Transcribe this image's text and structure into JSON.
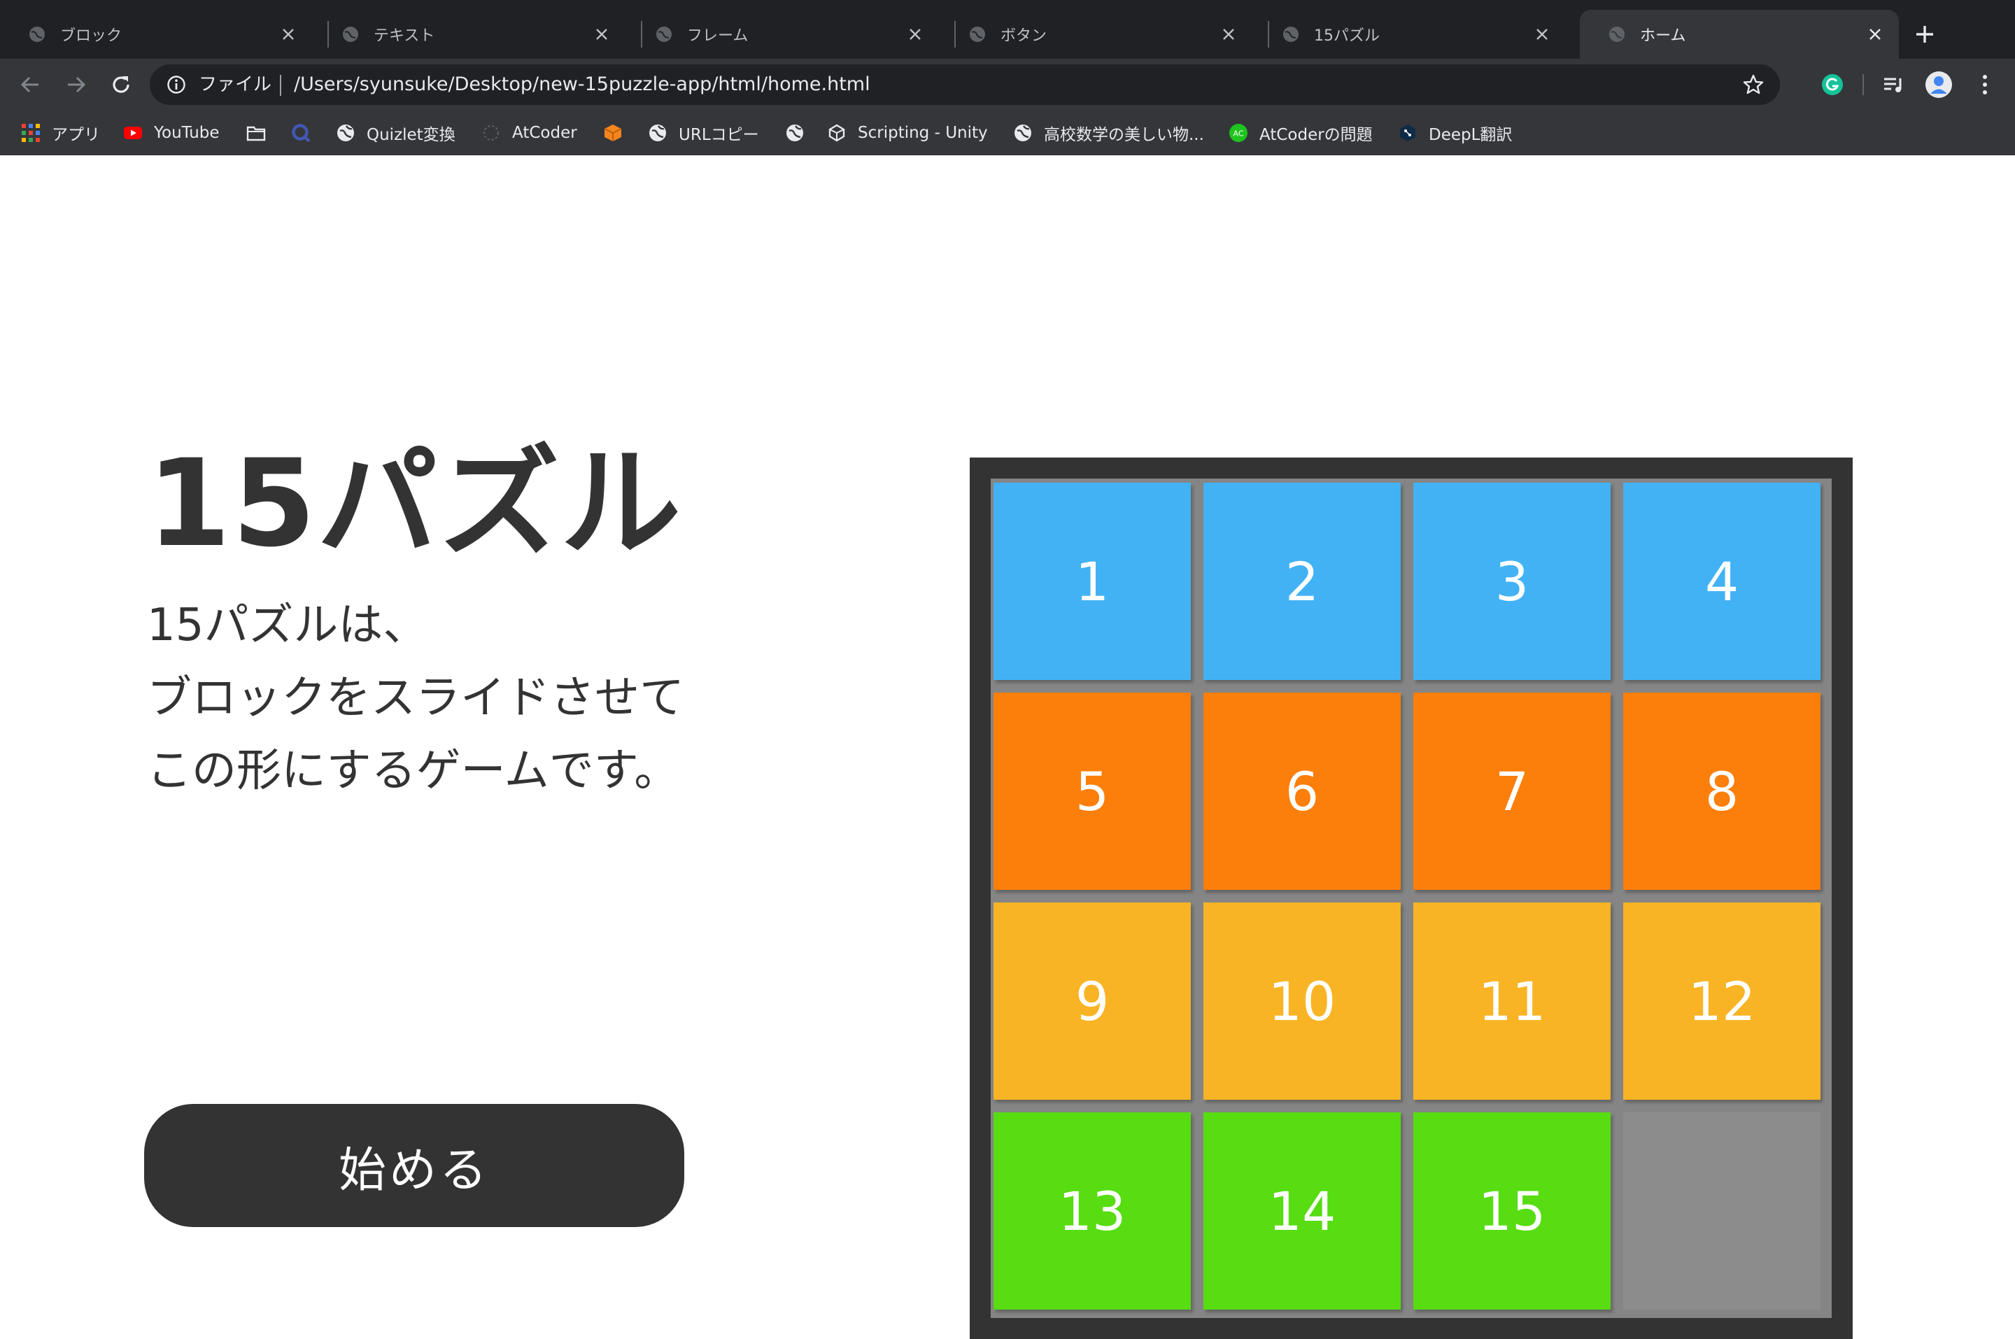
{
  "browser": {
    "tabs": [
      {
        "title": "ブロック",
        "active": false
      },
      {
        "title": "テキスト",
        "active": false
      },
      {
        "title": "フレーム",
        "active": false
      },
      {
        "title": "ボタン",
        "active": false
      },
      {
        "title": "15パズル",
        "active": false
      },
      {
        "title": "ホーム",
        "active": true
      }
    ],
    "address": {
      "scheme_label": "ファイル",
      "url": "/Users/syunsuke/Desktop/new-15puzzle-app/html/home.html"
    },
    "bookmarks": [
      {
        "label": "アプリ",
        "icon": "apps-grid-icon"
      },
      {
        "label": "YouTube",
        "icon": "youtube-icon"
      },
      {
        "label": "",
        "icon": "folder-icon"
      },
      {
        "label": "",
        "icon": "quizlet-icon"
      },
      {
        "label": "Quizlet変換",
        "icon": "globe-icon"
      },
      {
        "label": "AtCoder",
        "icon": "atcoder-icon"
      },
      {
        "label": "",
        "icon": "box-icon"
      },
      {
        "label": "URLコピー",
        "icon": "globe-icon"
      },
      {
        "label": "",
        "icon": "globe-icon"
      },
      {
        "label": "Scripting - Unity",
        "icon": "unity-icon"
      },
      {
        "label": "高校数学の美しい物...",
        "icon": "globe-icon"
      },
      {
        "label": "AtCoderの問題",
        "icon": "ac-icon"
      },
      {
        "label": "DeepL翻訳",
        "icon": "deepl-icon"
      }
    ]
  },
  "page": {
    "title": "15パズル",
    "description_lines": [
      "15パズルは、",
      "ブロックをスライドさせて",
      "この形にするゲームです。"
    ],
    "start_button_label": "始める"
  },
  "puzzle": {
    "tiles": [
      {
        "label": "1",
        "color": "#42b2f4"
      },
      {
        "label": "2",
        "color": "#42b2f4"
      },
      {
        "label": "3",
        "color": "#42b2f4"
      },
      {
        "label": "4",
        "color": "#42b2f4"
      },
      {
        "label": "5",
        "color": "#fc7e0b"
      },
      {
        "label": "6",
        "color": "#fc7e0b"
      },
      {
        "label": "7",
        "color": "#fc7e0b"
      },
      {
        "label": "8",
        "color": "#fc7e0b"
      },
      {
        "label": "9",
        "color": "#f8b424"
      },
      {
        "label": "10",
        "color": "#f8b424"
      },
      {
        "label": "11",
        "color": "#f8b424"
      },
      {
        "label": "12",
        "color": "#f8b424"
      },
      {
        "label": "13",
        "color": "#58dc12"
      },
      {
        "label": "14",
        "color": "#58dc12"
      },
      {
        "label": "15",
        "color": "#58dc12"
      },
      {
        "label": "",
        "color": "#8c8c8c"
      }
    ]
  },
  "colors": {
    "dark": "#333333",
    "chrome_bg": "#202124",
    "toolbar_bg": "#35363a"
  }
}
